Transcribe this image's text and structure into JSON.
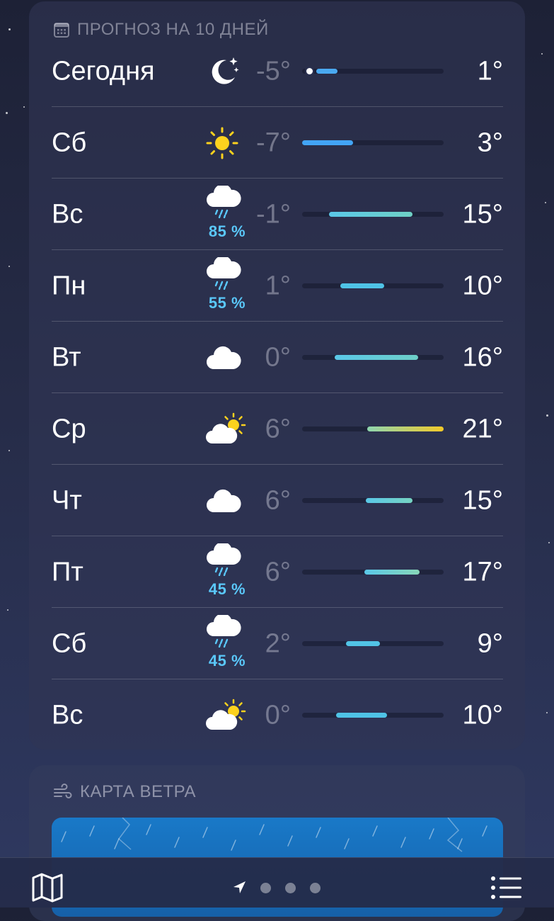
{
  "forecast": {
    "header": "ПРОГНОЗ НА 10 ДНЕЙ",
    "days": [
      {
        "day": "Сегодня",
        "icon": "moon-stars-icon",
        "precip": "",
        "low": "-5°",
        "high": "1°",
        "bar_start": 0.1,
        "bar_end": 0.25,
        "current": 0.1,
        "color": "#4aa9f0"
      },
      {
        "day": "Сб",
        "icon": "sun-icon",
        "precip": "",
        "low": "-7°",
        "high": "3°",
        "bar_start": 0.0,
        "bar_end": 0.36,
        "color": "#42a5f5"
      },
      {
        "day": "Вс",
        "icon": "cloud-rain-icon",
        "precip": "85 %",
        "low": "-1°",
        "high": "15°",
        "bar_start": 0.19,
        "bar_end": 0.78,
        "color": "#5ac8e0"
      },
      {
        "day": "Пн",
        "icon": "cloud-rain-icon",
        "precip": "55 %",
        "low": "1°",
        "high": "10°",
        "bar_start": 0.27,
        "bar_end": 0.58,
        "color": "#4fc3e6"
      },
      {
        "day": "Вт",
        "icon": "cloud-icon",
        "precip": "",
        "low": "0°",
        "high": "16°",
        "bar_start": 0.23,
        "bar_end": 0.82,
        "color": "#6dcfc8"
      },
      {
        "day": "Ср",
        "icon": "sun-cloud-icon",
        "precip": "",
        "low": "6°",
        "high": "21°",
        "bar_start": 0.46,
        "bar_end": 1.0,
        "color": "#e3cf4b"
      },
      {
        "day": "Чт",
        "icon": "cloud-icon",
        "precip": "",
        "low": "6°",
        "high": "15°",
        "bar_start": 0.45,
        "bar_end": 0.78,
        "color": "#76d3c2"
      },
      {
        "day": "Пт",
        "icon": "cloud-rain-icon",
        "precip": "45 %",
        "low": "6°",
        "high": "17°",
        "bar_start": 0.44,
        "bar_end": 0.83,
        "color": "#88d7b8"
      },
      {
        "day": "Сб",
        "icon": "cloud-rain-icon",
        "precip": "45 %",
        "low": "2°",
        "high": "9°",
        "bar_start": 0.31,
        "bar_end": 0.55,
        "color": "#52c4e6"
      },
      {
        "day": "Вс",
        "icon": "sun-cloud-icon",
        "precip": "",
        "low": "0°",
        "high": "10°",
        "bar_start": 0.24,
        "bar_end": 0.6,
        "color": "#4fc3e6"
      }
    ]
  },
  "wind": {
    "header": "КАРТА ВЕТРА"
  },
  "bottombar": {
    "icons": [
      "map-icon",
      "location-arrow-icon",
      "page-dot-icon",
      "list-icon"
    ]
  }
}
